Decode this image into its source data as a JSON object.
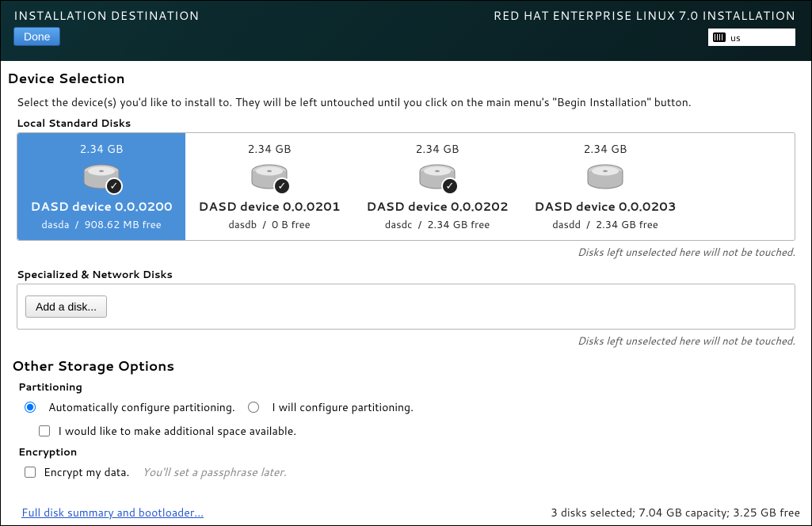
{
  "header": {
    "title": "INSTALLATION DESTINATION",
    "done_label": "Done",
    "product_title": "RED HAT ENTERPRISE LINUX 7.0 INSTALLATION",
    "keyboard_layout": "us"
  },
  "device_selection": {
    "title": "Device Selection",
    "intro": "Select the device(s) you'd like to install to.  They will be left untouched until you click on the main menu's \"Begin Installation\" button.",
    "local_label": "Local Standard Disks",
    "disks": [
      {
        "size": "2.34 GB",
        "name": "DASD device 0.0.0200",
        "dev": "dasda",
        "free": "908.62 MB free",
        "selected": true,
        "checked": true
      },
      {
        "size": "2.34 GB",
        "name": "DASD device 0.0.0201",
        "dev": "dasdb",
        "free": "0 B free",
        "selected": false,
        "checked": true
      },
      {
        "size": "2.34 GB",
        "name": "DASD device 0.0.0202",
        "dev": "dasdc",
        "free": "2.34 GB free",
        "selected": false,
        "checked": true
      },
      {
        "size": "2.34 GB",
        "name": "DASD device 0.0.0203",
        "dev": "dasdd",
        "free": "2.34 GB free",
        "selected": false,
        "checked": false
      }
    ],
    "hint": "Disks left unselected here will not be touched.",
    "specialized_label": "Specialized & Network Disks",
    "add_disk_label": "Add a disk..."
  },
  "other_options": {
    "title": "Other Storage Options",
    "partitioning_label": "Partitioning",
    "auto_label": "Automatically configure partitioning.",
    "manual_label": "I will configure partitioning.",
    "additional_space_label": "I would like to make additional space available.",
    "encryption_label": "Encryption",
    "encrypt_label": "Encrypt my data.",
    "encrypt_hint": "You'll set a passphrase later."
  },
  "footer": {
    "summary_link": "Full disk summary and bootloader...",
    "status": "3 disks selected; 7.04 GB capacity; 3.25 GB free"
  }
}
